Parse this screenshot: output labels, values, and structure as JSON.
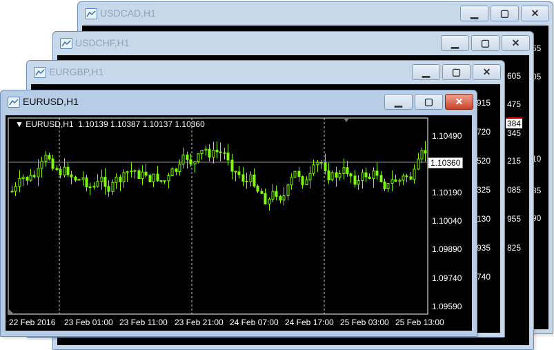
{
  "windows": [
    {
      "title": "USDCAD,H1",
      "peek": [
        "55",
        "605",
        "475",
        "345",
        "215",
        "085",
        "955",
        "825"
      ]
    },
    {
      "title": "USDCHF,H1",
      "peek": [
        "55",
        "10",
        "85",
        "90"
      ],
      "price_label": "384"
    },
    {
      "title": "EURGBP,H1",
      "peek": [
        "605",
        "475",
        "345",
        "215",
        "085",
        "955",
        "825"
      ]
    },
    {
      "title": "EURUSD,H1"
    }
  ],
  "peek_usdcad": [
    "55",
    "10",
    "85",
    "90"
  ],
  "peek_usdchf": [
    "605",
    "475",
    "345",
    "215",
    "085",
    "955",
    "825"
  ],
  "peek_usdchf_label": "384",
  "peek_eurgbp": [
    "915",
    "720",
    "520",
    "325",
    "130",
    "935",
    "740"
  ],
  "active_chart": {
    "symbol_line": "EURUSD,H1  1.10139 1.10387 1.10137 1.10360",
    "current_price": "1.10360",
    "price_scale": [
      "1.10490",
      "1.10190",
      "1.10040",
      "1.09890",
      "1.09740",
      "1.09590"
    ],
    "time_scale": [
      "22 Feb 2016",
      "23 Feb 01:00",
      "23 Feb 11:00",
      "23 Feb 21:00",
      "24 Feb 07:00",
      "24 Feb 17:00",
      "25 Feb 03:00",
      "25 Feb 13:00"
    ]
  },
  "colors": {
    "candle": "#7cfc00",
    "chart_bg": "#000000",
    "grid_line": "#ffffff"
  },
  "icons": [
    "chart-window-icon",
    "minimize-icon",
    "maximize-icon",
    "close-icon",
    "dropdown-triangle-icon"
  ]
}
